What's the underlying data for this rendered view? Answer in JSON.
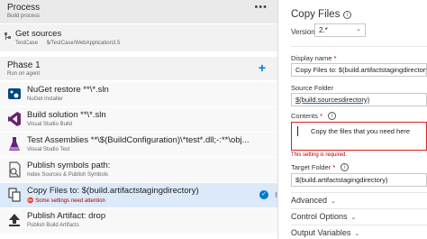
{
  "process": {
    "title": "Process",
    "subtitle": "Build process",
    "more": "•••"
  },
  "sources": {
    "title": "Get sources",
    "repo": "TestCase",
    "branch": "$/TestCase/WebApplication3.5"
  },
  "phase": {
    "title": "Phase 1",
    "subtitle": "Run on agent",
    "add": "+"
  },
  "tasks": [
    {
      "title": "NuGet restore **\\*.sln",
      "subtitle": "NuGet Installer",
      "icon": "nuget-icon"
    },
    {
      "title": "Build solution **\\*.sln",
      "subtitle": "Visual Studio Build",
      "icon": "visual-studio-icon"
    },
    {
      "title": "Test Assemblies **\\$(BuildConfiguration)\\*test*.dll;-:**\\obj...",
      "subtitle": "Visual Studio Test",
      "icon": "test-flask-icon"
    },
    {
      "title": "Publish symbols path:",
      "subtitle": "Index Sources & Publish Symbols",
      "icon": "symbols-icon"
    },
    {
      "title": "Copy Files to: $(build.artifactstagingdirectory)",
      "subtitle": "Some settings need attention",
      "icon": "copy-files-icon",
      "selected": true,
      "error": true
    },
    {
      "title": "Publish Artifact: drop",
      "subtitle": "Publish Build Artifacts",
      "icon": "upload-icon"
    }
  ],
  "panel": {
    "title": "Copy Files",
    "version_label": "Version",
    "version_value": "2.*",
    "display_name_label": "Display name",
    "display_name_value": "Copy Files to: $(build.artifactstagingdirectory)",
    "source_folder_label": "Source Folder",
    "source_folder_value": "$(build.sourcesdirectory)",
    "contents_label": "Contents",
    "contents_note": "Copy the files that you need here",
    "error_text": "This setting is required.",
    "target_folder_label": "Target Folder",
    "target_folder_value": "$(build.artifactstagingdirectory)",
    "sections": [
      "Advanced",
      "Control Options",
      "Output Variables"
    ]
  },
  "colors": {
    "accent": "#0078d4",
    "error": "#a80000",
    "selected": "#dbe9f8"
  }
}
